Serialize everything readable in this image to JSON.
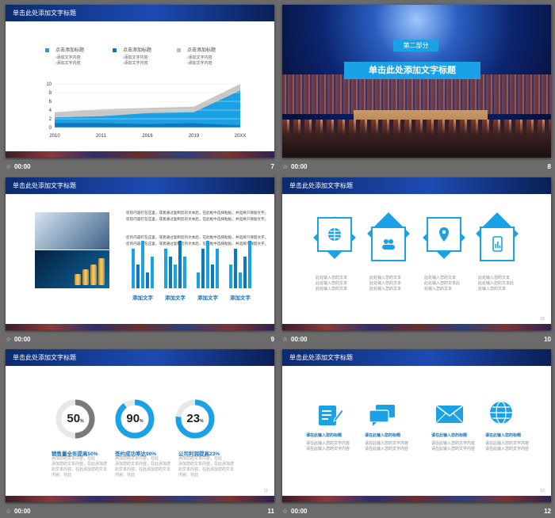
{
  "panels": [
    {
      "duration": "00:00",
      "number": "7"
    },
    {
      "duration": "00:00",
      "number": "8"
    },
    {
      "duration": "00:00",
      "number": "9"
    },
    {
      "duration": "00:00",
      "number": "10"
    },
    {
      "duration": "00:00",
      "number": "11"
    },
    {
      "duration": "00:00",
      "number": "12"
    }
  ],
  "slide7": {
    "title": "单击此处添加文字标题",
    "legend": [
      {
        "title": "点击添加标题",
        "color": "#1aa1e6",
        "lines": [
          "›添加文字内容",
          "›添加文字内容"
        ]
      },
      {
        "title": "点击添加标题",
        "color": "#0e78bf",
        "lines": [
          "›添加文字内容",
          "›添加文字内容"
        ]
      },
      {
        "title": "点击添加标题",
        "color": "#bdbdbd",
        "lines": [
          "›添加文字内容",
          "›添加文字内容"
        ]
      }
    ],
    "chart_data": {
      "type": "area",
      "categories": [
        "2010",
        "2011",
        "2016",
        "2019",
        "20XX"
      ],
      "series": [
        {
          "values": [
            3.5,
            4.2,
            4.5,
            4.8,
            10
          ],
          "color": "#c7c7c7"
        },
        {
          "values": [
            2.3,
            2.6,
            3.3,
            3.5,
            8.5
          ],
          "color": "#1aa1e6"
        },
        {
          "values": [
            1.0,
            1.0,
            0.8,
            1.0,
            0.5
          ],
          "color": "#0e78bf"
        }
      ],
      "ylim": [
        0,
        10
      ],
      "yticks": [
        "10",
        "8",
        "6",
        "4",
        "2",
        "0"
      ],
      "title": "",
      "xlabel": "",
      "ylabel": ""
    }
  },
  "slide8": {
    "part": "第二部分",
    "title": "单击此处添加文字标题"
  },
  "slide9": {
    "title": "单击此处添加文字标题",
    "paragraphs": [
      "您的内容打在这里，或者通过复制您的文本后，在此框中选择粘贴，并选择只保留文字。您的内容打在这里，或者通过复制您的文本后，在此框中选择粘贴，并选择只保留文字。",
      "您的内容打在这里，或者通过复制您的文本后，在此框中选择粘贴，并选择只保留文字。您的内容打在这里，或者通过复制您的文本后，在此框中选择粘贴，并选择只保留文字。"
    ],
    "bar_groups": [
      {
        "label": "添加文字",
        "values": [
          5,
          3,
          6,
          2,
          4
        ]
      },
      {
        "label": "添加文字",
        "values": [
          5,
          4,
          3,
          6,
          4
        ]
      },
      {
        "label": "添加文字",
        "values": [
          2,
          5,
          6,
          3,
          5
        ]
      },
      {
        "label": "添加文字",
        "values": [
          3,
          5,
          2,
          4,
          6
        ]
      }
    ]
  },
  "slide10": {
    "title": "单击此处添加文字标题",
    "icons": [
      "globe-icon",
      "users-icon",
      "location-icon",
      "mobile-chart-icon"
    ],
    "captions": [
      [
        "此处输入您的文本",
        "此处输入您的文本",
        "此处输入您的文本"
      ],
      [
        "此处输入您的文本",
        "此处输入您的文本",
        "此处输入您的文本"
      ],
      [
        "此处输入您的文本",
        "此处输入您的文本此",
        "处输入您的文本"
      ],
      [
        "此处输入您的文本",
        "此处输入您的文本此",
        "处输入您的文本"
      ]
    ],
    "page": "10"
  },
  "slide11": {
    "title": "单击此处添加文字标题",
    "rings": [
      {
        "value": "50",
        "pct": "%",
        "fraction": 0.5,
        "color": "#7a7a7a",
        "label": "销售量全年提高50%"
      },
      {
        "value": "90",
        "pct": "%",
        "fraction": 0.9,
        "color": "#1aa1e6",
        "label": "签约成功率达90%"
      },
      {
        "value": "23",
        "pct": "%",
        "fraction": 0.77,
        "color": "#1aa1e6",
        "label": "公司利润提高23%"
      }
    ],
    "desc": [
      "添加您的文本内容，在此",
      "添加您的文本内容，在此添加您的文本内容，在此添加您的文本内容，在此"
    ],
    "page": "11"
  },
  "slide12": {
    "title": "单击此处添加文字标题",
    "icons": [
      "edit-note-icon",
      "chat-icon",
      "mail-icon",
      "globe-icon"
    ],
    "headings": [
      "请在此输入您的标题",
      "请在此输入您的标题",
      "请在此输入您的标题",
      "请在此输入您的标题"
    ],
    "lines": [
      "请在此输入您的文字内容",
      "请在此输入您的文字内容"
    ],
    "page": "12"
  }
}
